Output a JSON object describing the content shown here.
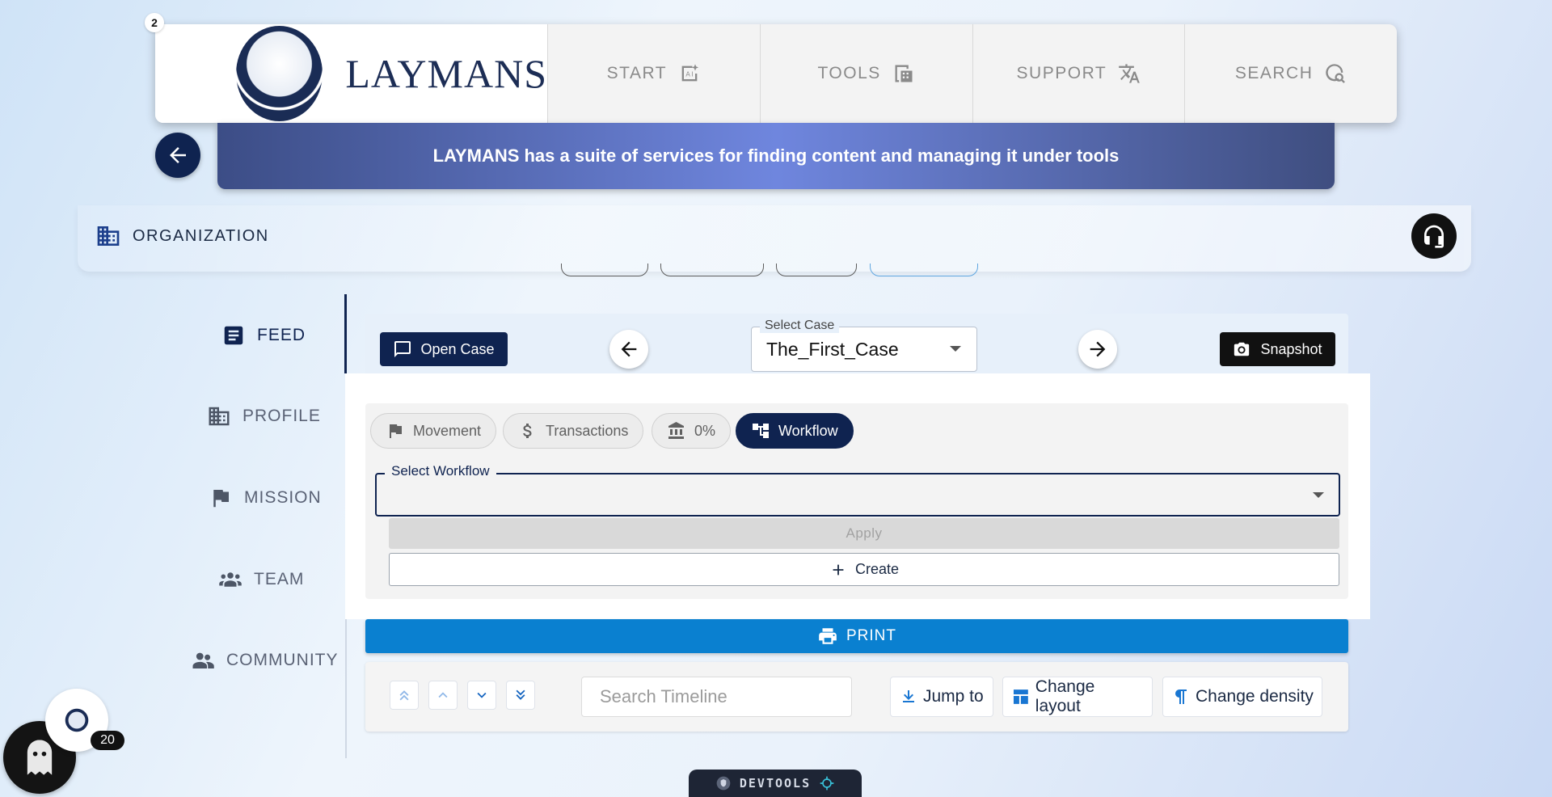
{
  "notifications": {
    "count": "2"
  },
  "brand": {
    "name": "LAYMANS"
  },
  "nav": {
    "items": [
      {
        "label": "START",
        "icon": "ai-sparkle-icon"
      },
      {
        "label": "TOOLS",
        "icon": "calculator-icon"
      },
      {
        "label": "SUPPORT",
        "icon": "translate-icon"
      },
      {
        "label": "SEARCH",
        "icon": "search-globe-icon"
      }
    ]
  },
  "banner": {
    "text": "LAYMANS has a suite of services for finding content and managing it under tools"
  },
  "org": {
    "title": "ORGANIZATION"
  },
  "sidebar": {
    "items": [
      {
        "label": "FEED",
        "icon": "article-icon",
        "active": true
      },
      {
        "label": "PROFILE",
        "icon": "building-icon"
      },
      {
        "label": "MISSION",
        "icon": "flag-icon"
      },
      {
        "label": "TEAM",
        "icon": "group-icon"
      },
      {
        "label": "COMMUNITY",
        "icon": "people-icon"
      }
    ]
  },
  "case_bar": {
    "open_case_label": "Open Case",
    "select_label": "Select Case",
    "select_value": "The_First_Case",
    "snapshot_label": "Snapshot"
  },
  "tabs": {
    "items": [
      {
        "label": "Movement",
        "icon": "flag-icon"
      },
      {
        "label": "Transactions",
        "icon": "dollar-icon"
      },
      {
        "label": "0%",
        "icon": "bank-icon"
      },
      {
        "label": "Workflow",
        "icon": "workflow-icon",
        "active": true
      }
    ]
  },
  "workflow": {
    "select_label": "Select Workflow",
    "select_value": "",
    "apply_label": "Apply",
    "create_label": "Create"
  },
  "print": {
    "label": "PRINT"
  },
  "timeline": {
    "search_placeholder": "Search Timeline",
    "jump_label": "Jump to",
    "layout_label": "Change layout",
    "density_label": "Change density"
  },
  "user": {
    "badge_count": "20"
  },
  "devtools": {
    "label": "DEVTOOLS"
  },
  "colors": {
    "navy": "#0f2350",
    "print_blue": "#0a80d0",
    "accent_blue": "#1976d2"
  }
}
